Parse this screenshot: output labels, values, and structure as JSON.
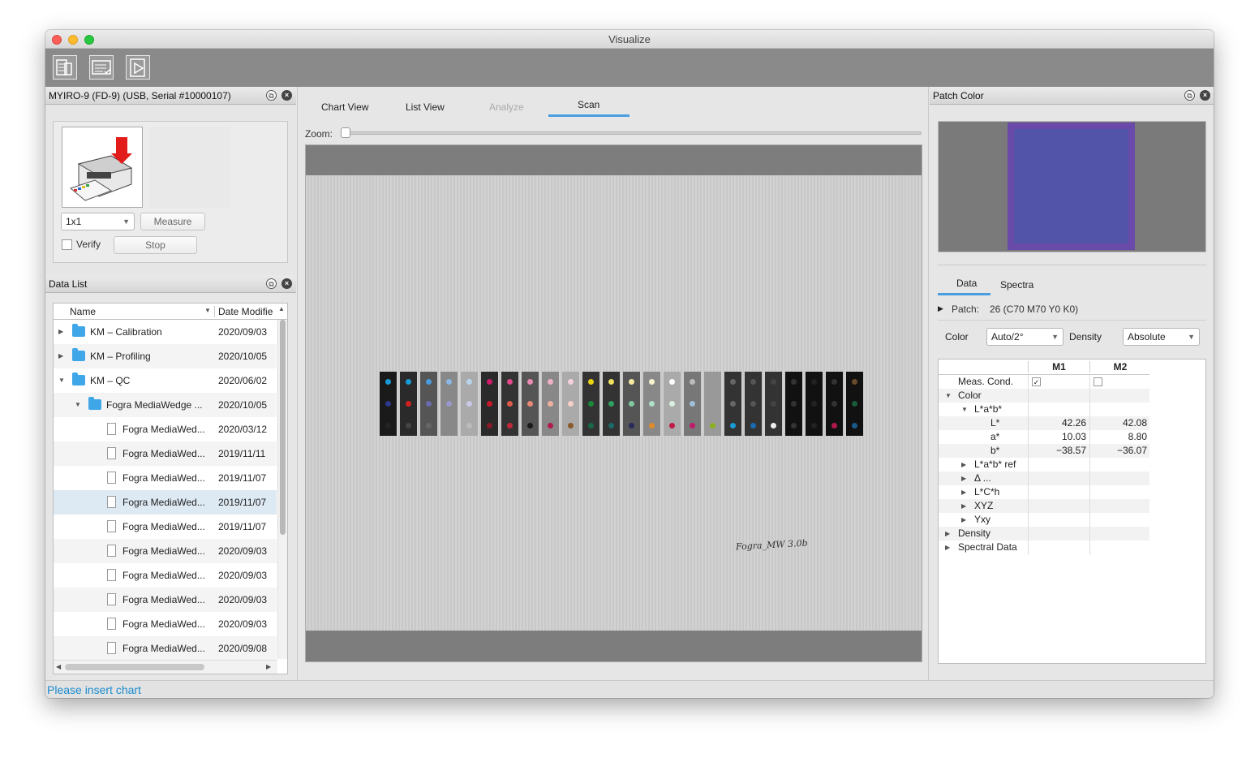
{
  "window": {
    "title": "Visualize"
  },
  "toolbar": {
    "icons": [
      "device-icon",
      "list-check-icon",
      "play-document-icon"
    ]
  },
  "device_panel": {
    "title": "MYIRO-9 (FD-9) (USB, Serial #10000107)",
    "aperture": "1x1",
    "measure_label": "Measure",
    "verify_label": "Verify",
    "stop_label": "Stop"
  },
  "data_list": {
    "title": "Data List",
    "col_name": "Name",
    "col_date": "Date Modifie",
    "rows": [
      {
        "name": "KM – Calibration",
        "date": "2020/09/03",
        "level": 0,
        "type": "folder",
        "expanded": false
      },
      {
        "name": "KM – Profiling",
        "date": "2020/10/05",
        "level": 0,
        "type": "folder",
        "expanded": false
      },
      {
        "name": "KM – QC",
        "date": "2020/06/02",
        "level": 0,
        "type": "folder",
        "expanded": true
      },
      {
        "name": "Fogra MediaWedge ...",
        "date": "2020/10/05",
        "level": 1,
        "type": "folder",
        "expanded": true
      },
      {
        "name": "Fogra MediaWed...",
        "date": "2020/03/12",
        "level": 2,
        "type": "file"
      },
      {
        "name": "Fogra MediaWed...",
        "date": "2019/11/11",
        "level": 2,
        "type": "file"
      },
      {
        "name": "Fogra MediaWed...",
        "date": "2019/11/07",
        "level": 2,
        "type": "file"
      },
      {
        "name": "Fogra MediaWed...",
        "date": "2019/11/07",
        "level": 2,
        "type": "file",
        "selected": true
      },
      {
        "name": "Fogra MediaWed...",
        "date": "2019/11/07",
        "level": 2,
        "type": "file"
      },
      {
        "name": "Fogra MediaWed...",
        "date": "2020/09/03",
        "level": 2,
        "type": "file"
      },
      {
        "name": "Fogra MediaWed...",
        "date": "2020/09/03",
        "level": 2,
        "type": "file"
      },
      {
        "name": "Fogra MediaWed...",
        "date": "2020/09/03",
        "level": 2,
        "type": "file"
      },
      {
        "name": "Fogra MediaWed...",
        "date": "2020/09/03",
        "level": 2,
        "type": "file"
      },
      {
        "name": "Fogra MediaWed...",
        "date": "2020/09/08",
        "level": 2,
        "type": "file"
      }
    ]
  },
  "center": {
    "tabs": [
      {
        "label": "Chart View",
        "active": false,
        "disabled": false
      },
      {
        "label": "List View",
        "active": false,
        "disabled": false
      },
      {
        "label": "Analyze",
        "active": false,
        "disabled": true
      },
      {
        "label": "Scan",
        "active": true,
        "disabled": false
      }
    ],
    "zoom_label": "Zoom:",
    "scan_annotation": "Fogra_MW 3.0b",
    "patch_colors": [
      "#1a1a1a",
      "#2a2a2a",
      "#555",
      "#888",
      "#aaa",
      "#2a2a2a",
      "#333",
      "#555",
      "#888",
      "#aaa",
      "#333",
      "#333",
      "#555",
      "#888",
      "#aaa",
      "#777",
      "#999",
      "#333",
      "#333",
      "#333",
      "#111",
      "#111",
      "#111",
      "#111"
    ],
    "dot_colors_top": [
      "#1a9ad6",
      "#1a9ad6",
      "#4a9be0",
      "#8ab7e6",
      "#b8d3ee",
      "#d01a6a",
      "#e04a8a",
      "#e98ab3",
      "#f0b0c8",
      "#f6d0de",
      "#e8d410",
      "#efe060",
      "#f5eaa0",
      "#f8f3cf",
      "#fff",
      "#bbb",
      "#999",
      "#666",
      "#555",
      "#444",
      "#333",
      "#222",
      "#333",
      "#6a4a2a"
    ],
    "dot_colors_mid": [
      "#2b3a8a",
      "#d02020",
      "#6a6ab0",
      "#9898cc",
      "#c8c8e6",
      "#c81a2a",
      "#e05a4a",
      "#e98878",
      "#f0b0a0",
      "#f6d0c8",
      "#1a8a3a",
      "#30a060",
      "#80c8a0",
      "#b0e0c8",
      "#d8f0e0",
      "#9fc0d8",
      "#999",
      "#666",
      "#555",
      "#444",
      "#333",
      "#222",
      "#333",
      "#1a5a3a"
    ],
    "dot_colors_bot": [
      "#222",
      "#444",
      "#666",
      "#888",
      "#bbb",
      "#8a1a2a",
      "#c02a3a",
      "#1a1a1a",
      "#b01a4a",
      "#8a5a2a",
      "#1a6a4a",
      "#1a6a6a",
      "#2a2a5a",
      "#e08a2a",
      "#c01a4a",
      "#c01a6a",
      "#8ab020",
      "#1a9ad6",
      "#1a6ab0",
      "#eee",
      "#333",
      "#222",
      "#b01a4a",
      "#1a5a8a"
    ]
  },
  "patch_panel": {
    "title": "Patch Color",
    "preview_outer": "#6a4aa8",
    "preview_inner": "#5154a8",
    "tabs": [
      {
        "label": "Data",
        "active": true
      },
      {
        "label": "Spectra",
        "active": false
      }
    ],
    "patch_label": "Patch:",
    "patch_value": "26 (C70 M70 Y0 K0)",
    "color_label": "Color",
    "color_value": "Auto/2°",
    "density_label": "Density",
    "density_value": "Absolute",
    "col_m1": "M1",
    "col_m2": "M2",
    "rows": [
      {
        "label": "Meas. Cond.",
        "indent": 0,
        "tw": "",
        "m1": "check",
        "m2": "uncheck"
      },
      {
        "label": "Color",
        "indent": 0,
        "tw": "down",
        "m1": "",
        "m2": ""
      },
      {
        "label": "L*a*b*",
        "indent": 1,
        "tw": "down",
        "m1": "",
        "m2": ""
      },
      {
        "label": "L*",
        "indent": 2,
        "tw": "",
        "m1": "42.26",
        "m2": "42.08"
      },
      {
        "label": "a*",
        "indent": 2,
        "tw": "",
        "m1": "10.03",
        "m2": "8.80"
      },
      {
        "label": "b*",
        "indent": 2,
        "tw": "",
        "m1": "−38.57",
        "m2": "−36.07"
      },
      {
        "label": "L*a*b* ref",
        "indent": 1,
        "tw": "right",
        "m1": "",
        "m2": ""
      },
      {
        "label": "Δ ...",
        "indent": 1,
        "tw": "right",
        "m1": "",
        "m2": ""
      },
      {
        "label": "L*C*h",
        "indent": 1,
        "tw": "right",
        "m1": "",
        "m2": ""
      },
      {
        "label": "XYZ",
        "indent": 1,
        "tw": "right",
        "m1": "",
        "m2": ""
      },
      {
        "label": "Yxy",
        "indent": 1,
        "tw": "right",
        "m1": "",
        "m2": ""
      },
      {
        "label": "Density",
        "indent": 0,
        "tw": "right",
        "m1": "",
        "m2": ""
      },
      {
        "label": "Spectral Data",
        "indent": 0,
        "tw": "right",
        "m1": "",
        "m2": ""
      }
    ]
  },
  "status": {
    "text": "Please insert chart"
  }
}
